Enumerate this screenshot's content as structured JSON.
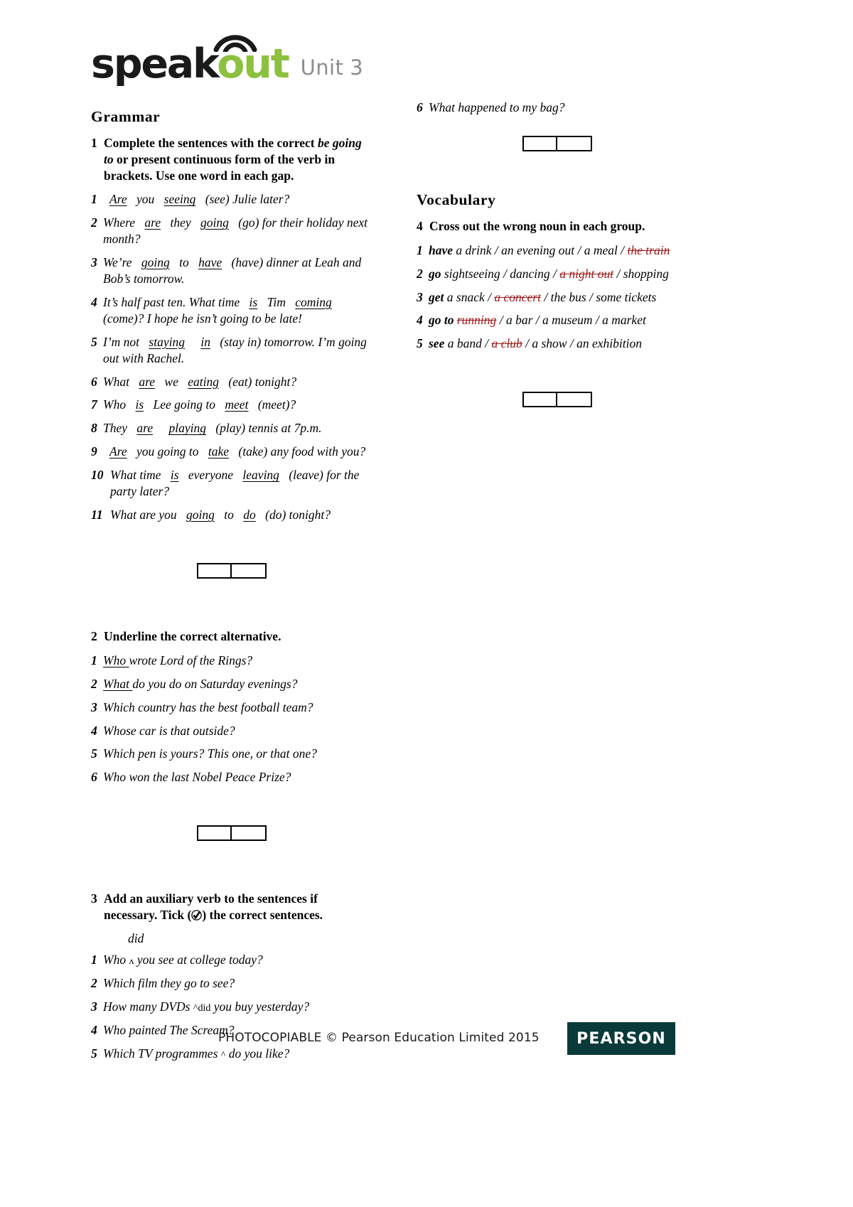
{
  "header": {
    "logo_primary": "speak",
    "logo_accent": "out",
    "unit_word": "Unit",
    "unit_number": "3",
    "accent_color": "#8cc03f",
    "wifi_icon": "wifi-arc-icon"
  },
  "left_column": {
    "section_title": "Grammar",
    "exercise1": {
      "number": "1",
      "instruction_parts": {
        "p1": "Complete the sentences with the correct ",
        "i1": "be going to",
        "p2": " or present continuous form of the verb in brackets. Use one word in each gap."
      },
      "items": [
        {
          "n": "1",
          "a": "",
          "ans1": "Are",
          "b": "you",
          "ans2": "seeing",
          "c": "(see) Julie later?"
        },
        {
          "n": "2",
          "a": "Where",
          "ans1": "are",
          "b": "they",
          "ans2": "going",
          "c": "(go) for their holiday next month?"
        },
        {
          "n": "3",
          "a": "We’re",
          "ans1": "going",
          "b": "to",
          "ans2": "have",
          "c": "(have) dinner at Leah and Bob’s tomorrow."
        },
        {
          "n": "4",
          "a": "It’s half past ten. What time",
          "ans1": "is",
          "b": "Tim",
          "ans2": "coming",
          "c": "(come)? I hope he isn’t going to be late!"
        },
        {
          "n": "5",
          "a": "I’m not",
          "ans1": "staying",
          "b": "",
          "ans2": "in",
          "c": "(stay in) tomorrow. I’m going out with Rachel."
        },
        {
          "n": "6",
          "a": "What",
          "ans1": "are",
          "b": "we",
          "ans2": "eating",
          "c": "(eat) tonight?"
        },
        {
          "n": "7",
          "a": "Who",
          "ans1": "is",
          "b": "Lee going to",
          "ans2": "meet",
          "c": "(meet)?"
        },
        {
          "n": "8",
          "a": "They",
          "ans1": "are",
          "b": "",
          "ans2": "playing",
          "c": "(play) tennis at 7p.m."
        },
        {
          "n": "9",
          "a": "",
          "ans1": "Are",
          "b": "you going to",
          "ans2": "take",
          "c": "(take) any food with you?"
        },
        {
          "n": "10",
          "a": "What time",
          "ans1": "is",
          "b": "everyone",
          "ans2": "leaving",
          "c": "(leave) for the party later?"
        },
        {
          "n": "11",
          "a": "What are you",
          "ans1": "going",
          "b": "to",
          "ans2": "do",
          "c": "(do) tonight?"
        }
      ]
    },
    "exercise2": {
      "number": "2",
      "instruction": "Underline the correct alternative.",
      "items": [
        {
          "n": "1",
          "underlined": "Who",
          "rest": " wrote Lord of the Rings?"
        },
        {
          "n": "2",
          "underlined": "What",
          "rest": "do you do on Saturday evenings?"
        },
        {
          "n": "3",
          "underlined": "",
          "rest": "Which country has the best football team?"
        },
        {
          "n": "4",
          "underlined": "",
          "rest": "Whose car is that outside?"
        },
        {
          "n": "5",
          "underlined": "",
          "rest": "Which pen is yours? This one, or that one?"
        },
        {
          "n": "6",
          "underlined": "",
          "rest": "Who won the last Nobel Peace Prize?"
        }
      ]
    },
    "exercise3": {
      "number": "3",
      "instruction_p1": "Add an auxiliary verb to the sentences if necessary. Tick (",
      "tick_icon": "tick-circle-icon",
      "instruction_p2": ") the correct sentences.",
      "annotation": "did",
      "items": [
        {
          "n": "1",
          "text_before": "Who ",
          "caret": "ʌ",
          "text_after": " you see at college today?"
        },
        {
          "n": "2",
          "text_before": "Which film they go to see?",
          "caret": "",
          "text_after": ""
        },
        {
          "n": "3",
          "text_before": "How many DVDs ",
          "caret": "^did",
          "text_after": " you buy yesterday?"
        },
        {
          "n": "4",
          "text_before": "Who painted The Scream?",
          "caret": "",
          "text_after": ""
        },
        {
          "n": "5",
          "text_before": "Which TV programmes ",
          "caret": "^",
          "text_after": " do you like?"
        }
      ]
    }
  },
  "right_column": {
    "exercise2_cont": {
      "items": [
        {
          "n": "6",
          "text": "What happened to my bag?"
        }
      ]
    },
    "section_title": "Vocabulary",
    "exercise4": {
      "number": "4",
      "instruction": "Cross out the wrong noun in each group.",
      "items": [
        {
          "n": "1",
          "verb": "have",
          "options": [
            "a drink",
            "an evening out",
            "a meal",
            "the train"
          ],
          "crossed_index": 3
        },
        {
          "n": "2",
          "verb": "go",
          "options": [
            "sightseeing",
            "dancing",
            "a night out",
            "shopping"
          ],
          "crossed_index": 2
        },
        {
          "n": "3",
          "verb": "get",
          "options": [
            "a snack",
            "a concert",
            "the bus",
            "some tickets"
          ],
          "crossed_index": 1
        },
        {
          "n": "4",
          "verb": "go to",
          "options": [
            "running",
            "a bar",
            "a museum",
            "a market"
          ],
          "crossed_index": 0
        },
        {
          "n": "5",
          "verb": "see",
          "options": [
            "a band",
            "a club",
            "a show",
            "an exhibition"
          ],
          "crossed_index": 1
        }
      ],
      "strike_color": "#9b1b1b"
    }
  },
  "score_boxes": {
    "label": "score-box",
    "left_value": "",
    "right_value": ""
  },
  "footer": {
    "copyright": "PHOTOCOPIABLE © Pearson Education Limited 2015",
    "brand": "PEARSON",
    "brand_bg": "#0a3a3a"
  }
}
